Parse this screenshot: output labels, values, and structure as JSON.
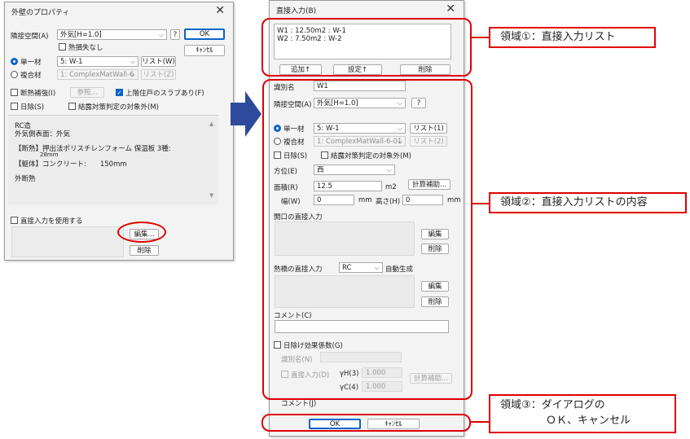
{
  "left_dialog": {
    "title": "外壁のプロパティ",
    "adjacent_label": "隣接空間(A)",
    "adjacent_value": "外気[H=1.0]",
    "help_btn": "?",
    "ok": "OK",
    "cancel": "ｷｬﾝｾﾙ",
    "thermal_loss": "熱損失なし",
    "single_label": "単一材",
    "single_value": "5: W-1",
    "list_w": "リスト(W)",
    "composite_label": "複合材",
    "composite_value": "1: ComplexMatWall-6",
    "list_z": "リスト(Z)",
    "insulation_label": "断熱補強(I)",
    "ref_btn": "参照...",
    "upper_slab": "上階住戸のスラブあり(F)",
    "shade": "日除(S)",
    "condensation": "結露対策判定の対象外(M)",
    "info_lines": [
      "RC造",
      "外気側表面：外気",
      "【断熱】押出法ポリスチレンフォーム 保温板 3種:",
      "28mm",
      "【躯体】コンクリート:　　150mm",
      "外断熱"
    ],
    "direct_input": "直接入力を使用する",
    "edit_btn": "編集...",
    "delete_btn": "削除"
  },
  "right_dialog": {
    "title": "直接入力(B)",
    "list_items": [
      "W1 : 12.50m2 : W-1",
      "W2 : 7.50m2 : W-2"
    ],
    "add_btn": "追加↑",
    "set_btn": "設定↑",
    "delete_btn": "削除",
    "id_label": "識別名",
    "id_value": "W1",
    "adjacent_label": "隣接空間(A)",
    "adjacent_value": "外気[H=1.0]",
    "help_btn": "?",
    "single_label": "単一材",
    "single_value": "5: W-1",
    "list_1": "リスト(1)",
    "composite_label": "複合材",
    "composite_value": "1: ComplexMatWall-6-01",
    "list_2": "リスト(2)",
    "shade": "日除(S)",
    "condensation": "結露対策判定の対象外(M)",
    "direction_label": "方位(E)",
    "direction_value": "西",
    "area_label": "面積(R)",
    "area_value": "12.5",
    "area_unit": "m2",
    "calc_btn": "計算補助...",
    "width_label": "幅(W)",
    "width_value": "0",
    "width_unit": "mm",
    "height_label": "高さ(H)",
    "height_value": "0",
    "height_unit": "mm",
    "opening_label": "開口の直接入力",
    "opening_edit": "編集",
    "opening_delete": "削除",
    "bridge_label": "熱橋の直接入力",
    "bridge_value": "RC",
    "auto_gen": "自動生成",
    "bridge_edit": "編集",
    "bridge_delete": "削除",
    "comment_label": "コメント(C)",
    "shade_effect": "日除け効果係数(G)",
    "shade_id_label": "識別名(N)",
    "shade_direct": "直接入力(D)",
    "gamma_h_label": "γH(3)",
    "gamma_h_value": "1.000",
    "gamma_c_label": "γC(4)",
    "gamma_c_value": "1.000",
    "shade_calc_btn": "計算補助...",
    "comment2_label": "コメント(J)",
    "ok": "OK",
    "cancel": "ｷｬﾝｾﾙ"
  },
  "annotations": {
    "region1": "領域①：直接入力リスト",
    "region2": "領域②：直接入力リストの内容",
    "region3_line1": "領域③：ダイアログの",
    "region3_line2": "ＯＫ、キャンセル"
  },
  "colors": {
    "highlight": "#e00000",
    "arrow": "#2e4a9c",
    "accent": "#0a64c8"
  }
}
